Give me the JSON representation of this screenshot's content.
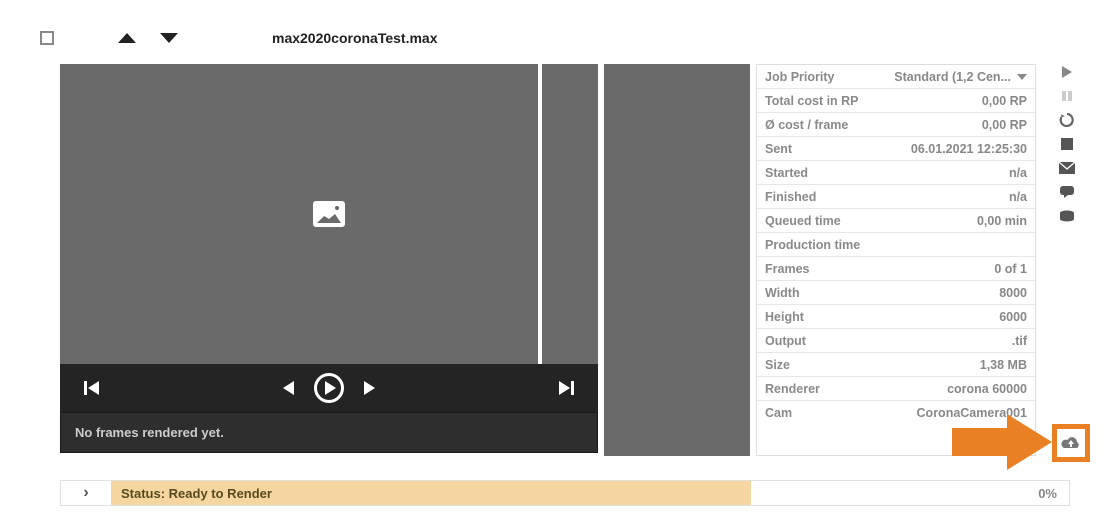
{
  "header": {
    "filename": "max2020coronaTest.max"
  },
  "preview": {
    "no_frames_msg": "No frames rendered yet."
  },
  "info": {
    "rows": [
      {
        "label": "Job Priority",
        "value": "Standard (1,2 Cen...",
        "dropdown": true
      },
      {
        "label": "Total cost in RP",
        "value": "0,00 RP"
      },
      {
        "label": "Ø cost / frame",
        "value": "0,00 RP"
      },
      {
        "label": "Sent",
        "value": "06.01.2021 12:25:30"
      },
      {
        "label": "Started",
        "value": "n/a"
      },
      {
        "label": "Finished",
        "value": "n/a"
      },
      {
        "label": "Queued time",
        "value": "0,00 min"
      },
      {
        "label": "Production time",
        "value": ""
      },
      {
        "label": "Frames",
        "value": "0 of 1"
      },
      {
        "label": "Width",
        "value": "8000"
      },
      {
        "label": "Height",
        "value": "6000"
      },
      {
        "label": "Output",
        "value": ".tif"
      },
      {
        "label": "Size",
        "value": "1,38 MB"
      },
      {
        "label": "Renderer",
        "value": "corona 60000"
      },
      {
        "label": "Cam",
        "value": "CoronaCamera001"
      }
    ]
  },
  "status": {
    "text": "Status: Ready to Render",
    "percent": "0%"
  }
}
